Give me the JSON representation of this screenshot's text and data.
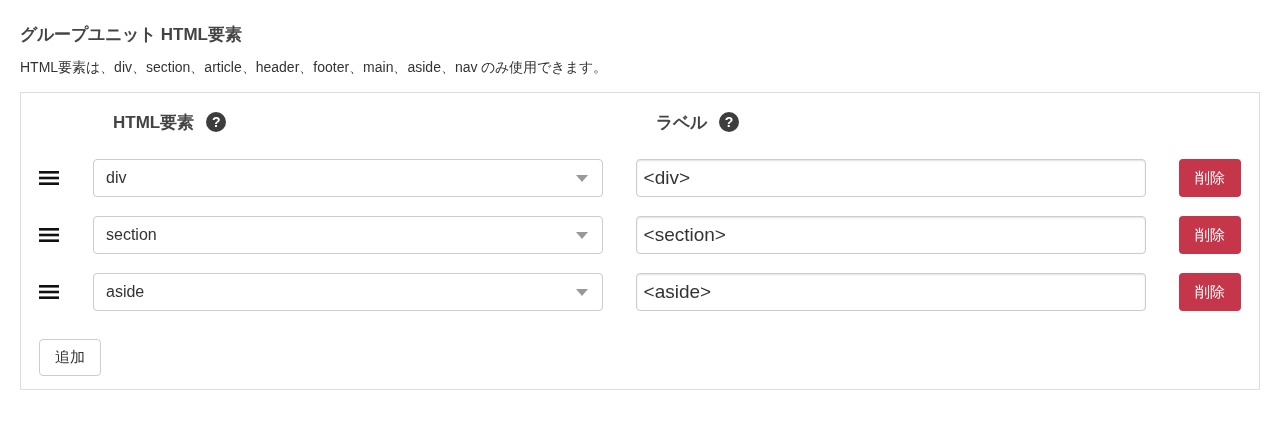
{
  "title": "グループユニット HTML要素",
  "description": "HTML要素は、div、section、article、header、footer、main、aside、nav のみ使用できます。",
  "columns": [
    {
      "label": "HTML要素",
      "help": "?"
    },
    {
      "label": "ラベル",
      "help": "?"
    }
  ],
  "rows": [
    {
      "element": "div",
      "label": "<div>",
      "delete": "削除"
    },
    {
      "element": "section",
      "label": "<section>",
      "delete": "削除"
    },
    {
      "element": "aside",
      "label": "<aside>",
      "delete": "削除"
    }
  ],
  "add_button": "追加"
}
